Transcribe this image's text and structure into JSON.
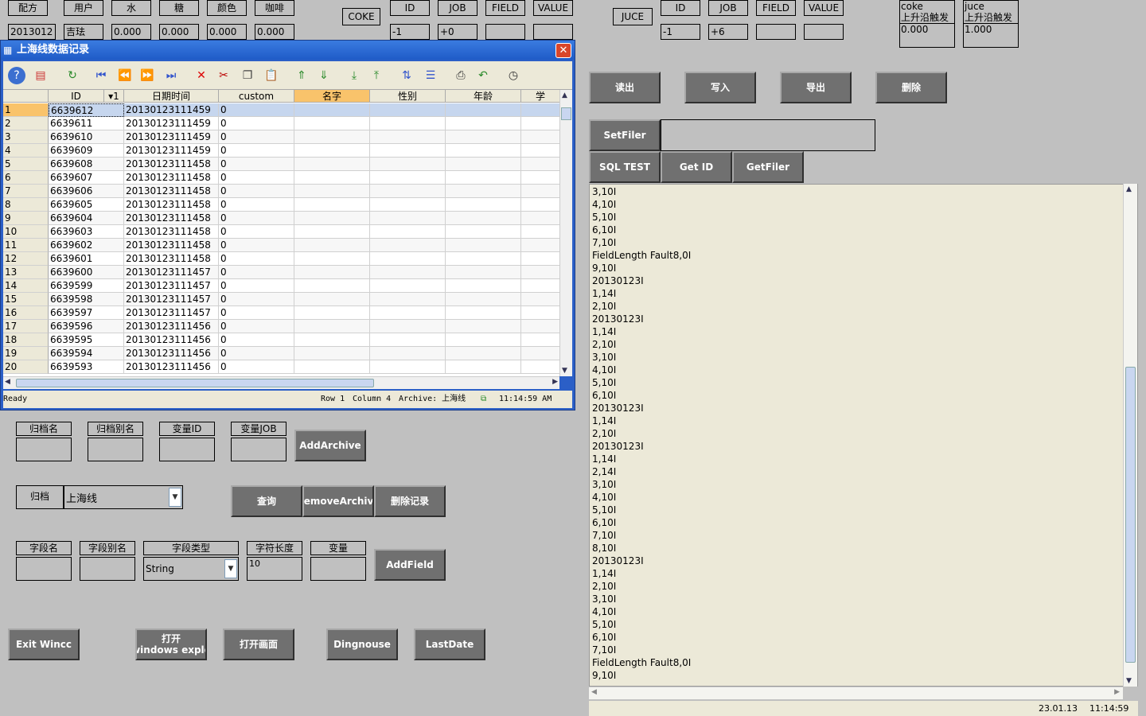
{
  "top_left_headers": [
    "配方",
    "用户",
    "水",
    "糖",
    "颜色",
    "咖啡"
  ],
  "top_left_values": [
    "2013012",
    "吉珐",
    "0.000",
    "0.000",
    "0.000",
    "0.000"
  ],
  "coke": {
    "label": "COKE",
    "headers": [
      "ID",
      "JOB",
      "FIELD",
      "VALUE"
    ],
    "values": [
      "-1",
      "+0",
      "",
      ""
    ]
  },
  "juce": {
    "label": "JUCE",
    "headers": [
      "ID",
      "JOB",
      "FIELD",
      "VALUE"
    ],
    "values": [
      "-1",
      "+6",
      "",
      ""
    ]
  },
  "coke_box": {
    "name": "coke",
    "trigger": "上升沿触发",
    "value": "0.000"
  },
  "juce_box": {
    "name": "juce",
    "trigger": "上升沿触发",
    "value": "1.000"
  },
  "window": {
    "title": "上海线数据记录",
    "close": "✕",
    "columns": [
      "ID",
      "▾1",
      "日期时间",
      "custom",
      "名字",
      "性别",
      "年龄",
      "学"
    ],
    "rows": [
      {
        "n": "1",
        "id": "6639612",
        "dt": "20130123111459",
        "c": "0"
      },
      {
        "n": "2",
        "id": "6639611",
        "dt": "20130123111459",
        "c": "0"
      },
      {
        "n": "3",
        "id": "6639610",
        "dt": "20130123111459",
        "c": "0"
      },
      {
        "n": "4",
        "id": "6639609",
        "dt": "20130123111459",
        "c": "0"
      },
      {
        "n": "5",
        "id": "6639608",
        "dt": "20130123111458",
        "c": "0"
      },
      {
        "n": "6",
        "id": "6639607",
        "dt": "20130123111458",
        "c": "0"
      },
      {
        "n": "7",
        "id": "6639606",
        "dt": "20130123111458",
        "c": "0"
      },
      {
        "n": "8",
        "id": "6639605",
        "dt": "20130123111458",
        "c": "0"
      },
      {
        "n": "9",
        "id": "6639604",
        "dt": "20130123111458",
        "c": "0"
      },
      {
        "n": "10",
        "id": "6639603",
        "dt": "20130123111458",
        "c": "0"
      },
      {
        "n": "11",
        "id": "6639602",
        "dt": "20130123111458",
        "c": "0"
      },
      {
        "n": "12",
        "id": "6639601",
        "dt": "20130123111458",
        "c": "0"
      },
      {
        "n": "13",
        "id": "6639600",
        "dt": "20130123111457",
        "c": "0"
      },
      {
        "n": "14",
        "id": "6639599",
        "dt": "20130123111457",
        "c": "0"
      },
      {
        "n": "15",
        "id": "6639598",
        "dt": "20130123111457",
        "c": "0"
      },
      {
        "n": "16",
        "id": "6639597",
        "dt": "20130123111457",
        "c": "0"
      },
      {
        "n": "17",
        "id": "6639596",
        "dt": "20130123111456",
        "c": "0"
      },
      {
        "n": "18",
        "id": "6639595",
        "dt": "20130123111456",
        "c": "0"
      },
      {
        "n": "19",
        "id": "6639594",
        "dt": "20130123111456",
        "c": "0"
      },
      {
        "n": "20",
        "id": "6639593",
        "dt": "20130123111456",
        "c": "0"
      }
    ],
    "status": {
      "ready": "Ready",
      "row": "Row 1",
      "column": "Column 4",
      "archive": "Archive: 上海线",
      "time": "11:14:59 AM"
    }
  },
  "right_buttons": {
    "read": "读出",
    "write": "写入",
    "export": "导出",
    "delete": "删除",
    "setfiler": "SetFiler",
    "sqltest": "SQL TEST",
    "getid": "Get ID",
    "getfiler": "GetFiler"
  },
  "log_lines": [
    "3,10I",
    "4,10I",
    "5,10I",
    "6,10I",
    "7,10I",
    "FieldLength Fault8,0I",
    "9,10I",
    "20130123I",
    "1,14I",
    "2,10I",
    "20130123I",
    "1,14I",
    "2,10I",
    "3,10I",
    "4,10I",
    "5,10I",
    "6,10I",
    "20130123I",
    "1,14I",
    "2,10I",
    "20130123I",
    "1,14I",
    "2,14I",
    "3,10I",
    "4,10I",
    "5,10I",
    "6,10I",
    "7,10I",
    "8,10I",
    "20130123I",
    "1,14I",
    "2,10I",
    "3,10I",
    "4,10I",
    "5,10I",
    "6,10I",
    "7,10I",
    "FieldLength Fault8,0I",
    "9,10I"
  ],
  "right_status": {
    "date": "23.01.13",
    "time": "11:14:59"
  },
  "archive_form": {
    "labels": [
      "归档名",
      "归档别名",
      "变量ID",
      "变量JOB"
    ],
    "add": "AddArchive"
  },
  "archive_select": {
    "label": "归档",
    "value": "上海线",
    "query": "查询",
    "remove": "RemoveArchive",
    "delrec": "删除记录"
  },
  "field_form": {
    "labels": [
      "字段名",
      "字段别名",
      "字段类型",
      "字符长度",
      "变量"
    ],
    "type_value": "String",
    "length_value": "10",
    "add": "AddField"
  },
  "bottom_buttons": {
    "exit": "Exit Wincc",
    "open_line1": "打开",
    "open_line2": "windows explo",
    "open_screen": "打开画面",
    "dingnouse": "Dingnouse",
    "lastdate": "LastDate"
  }
}
